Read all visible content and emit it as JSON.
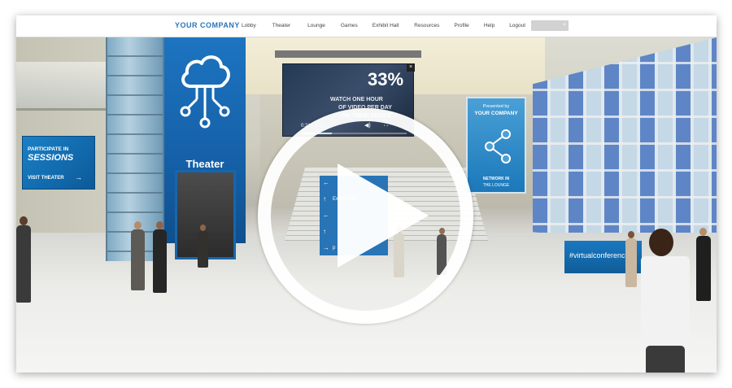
{
  "nav": {
    "brand": "YOUR COMPANY",
    "items": [
      "Lobby",
      "Theater",
      "Lounge",
      "Games",
      "Exhibit Hall",
      "Resources",
      "Profile",
      "Help",
      "Logout"
    ],
    "search_icon": "search-icon"
  },
  "theater_sign": {
    "label": "Theater",
    "icon": "cloud-network-icon"
  },
  "sessions_sign": {
    "line1": "PARTICIPATE IN",
    "line2": "SESSIONS",
    "cta": "VISIT THEATER",
    "arrow": "→"
  },
  "video_screen": {
    "headline": "33%",
    "line1": "WATCH ONE HOUR",
    "line2": "OF VIDEO PER DAY",
    "line3": "ON THEIR DEVICE",
    "timecode": "0:21 / 1:13",
    "progress": 0.29,
    "close": "×"
  },
  "network_sign": {
    "presented": "Presented by",
    "company": "YOUR COMPANY",
    "network": "NETWORK IN",
    "lounge": "THE LOUNGE"
  },
  "directory": {
    "rows": [
      {
        "arrow": "←",
        "text": ""
      },
      {
        "arrow": "↑",
        "text": "Exhibit Hall"
      },
      {
        "arrow": "←",
        "text": ""
      },
      {
        "arrow": "↑",
        "text": ""
      },
      {
        "arrow": "→",
        "text": "p"
      }
    ]
  },
  "desk": {
    "label": "#virtualconference"
  },
  "colors": {
    "brand": "#2a74b8",
    "sign_blue": "#1a78c0"
  }
}
